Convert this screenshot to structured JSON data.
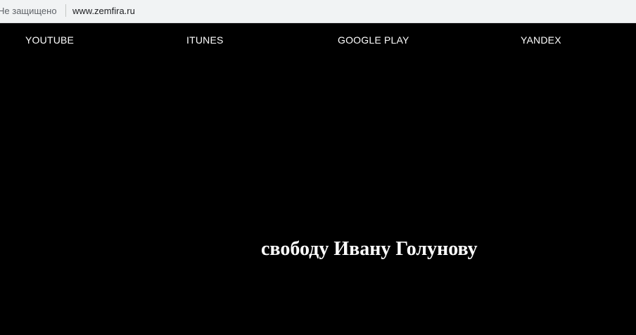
{
  "browser": {
    "security_label": "Не защищено",
    "url": "www.zemfira.ru"
  },
  "nav": {
    "links": [
      {
        "label": "YOUTUBE"
      },
      {
        "label": "ITUNES"
      },
      {
        "label": "GOOGLE PLAY"
      },
      {
        "label": "YANDEX"
      }
    ]
  },
  "main": {
    "headline": "свободу Ивану Голунову"
  },
  "colors": {
    "page_background": "#000000",
    "text": "#ffffff",
    "address_bar_background": "#f1f3f4"
  }
}
